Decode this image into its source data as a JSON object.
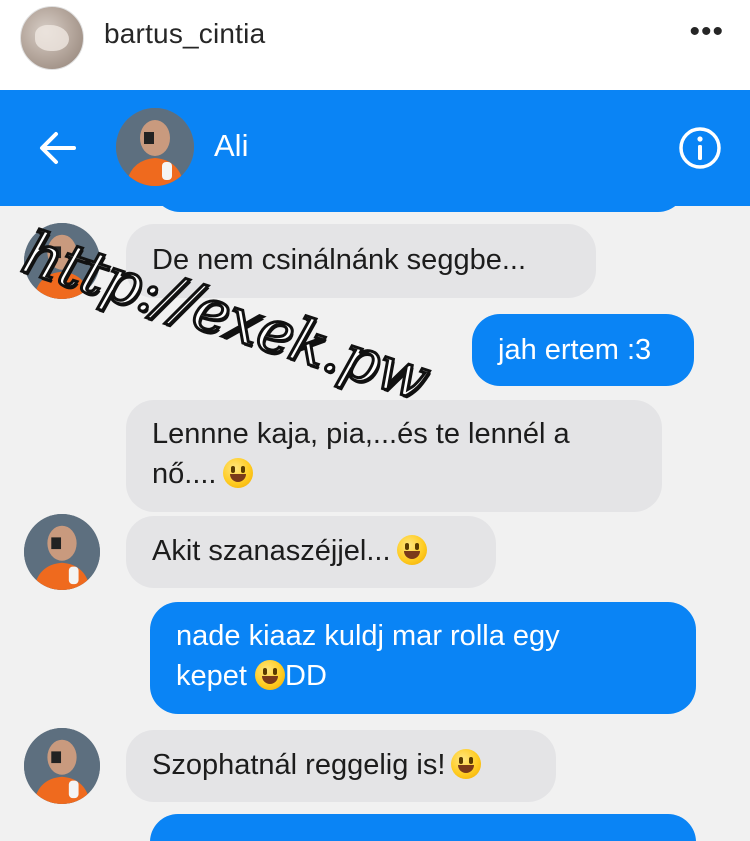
{
  "post": {
    "username": "bartus_cintia",
    "more_icon": "more-horizontal-icon"
  },
  "messenger": {
    "contact_name": "Ali",
    "back_icon": "arrow-left-icon",
    "info_icon": "info-circle-icon",
    "accent_color": "#0a84f5"
  },
  "messages": [
    {
      "from": "contact",
      "text": "De nem csinálnánk seggbe..."
    },
    {
      "from": "me",
      "text": "jah ertem :3"
    },
    {
      "from": "contact",
      "text_line1": "Lennne kaja, pia,...és te lennél a",
      "text_line2": "nő...."
    },
    {
      "from": "contact",
      "text": "Akit szanaszéjjel..."
    },
    {
      "from": "me",
      "text_line1": "nade kiaaz kuldj mar rolla egy",
      "text_line2_pre": "kepet ",
      "text_line2_post": "DD"
    },
    {
      "from": "contact",
      "text": "Szophatnál reggelig is!"
    }
  ],
  "watermark": "http://exek.pw"
}
